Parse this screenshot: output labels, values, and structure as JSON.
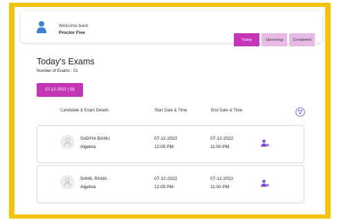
{
  "header": {
    "welcome_text": "Welcome back",
    "user_name": "Proctor Five",
    "tabs": [
      {
        "label": "Today",
        "active": true
      },
      {
        "label": "Upcoming",
        "active": false
      },
      {
        "label": "Completed",
        "active": false
      }
    ]
  },
  "main": {
    "title": "Today's Exams",
    "exam_count": "Number of Exams : 01",
    "date_button": "07-12-2022 | 08",
    "columns": {
      "candidate": "Candidate & Exam Details",
      "start": "Start Date & Time",
      "end": "End Date & Time"
    },
    "rows": [
      {
        "name": "SADIYA BANU",
        "subject": "Algebra",
        "start_date": "07-12-2022",
        "start_time": "12:05 PM",
        "end_date": "07-12-2022",
        "end_time": "11:00 PM"
      },
      {
        "name": "SAHIL RANA",
        "subject": "Algebra",
        "start_date": "07-12-2022",
        "start_time": "12:05 PM",
        "end_date": "07-12-2022",
        "end_time": "11:00 PM"
      }
    ]
  },
  "icons": [
    "user-icon",
    "filter-icon",
    "avatar-icon",
    "proctor-icon"
  ],
  "colors": {
    "frame": "#f4c20d",
    "accent": "#c536b6",
    "tab_inactive": "#e9b9e5",
    "icon_blue": "#3f7fd1",
    "icon_purple": "#7a4fd6",
    "card_border": "#d6d4ec"
  }
}
